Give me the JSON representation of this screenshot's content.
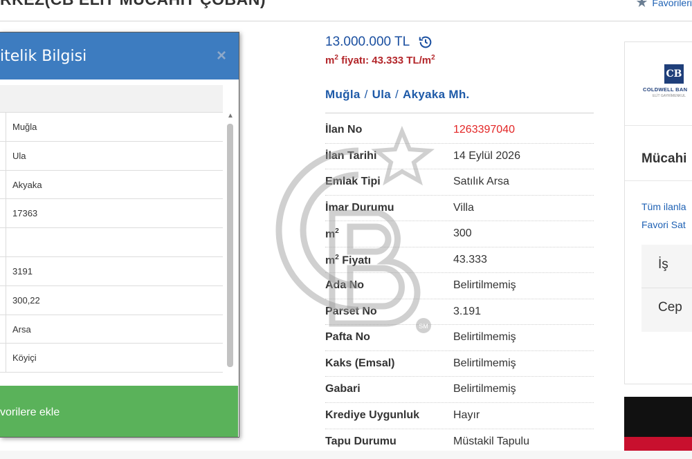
{
  "header": {
    "title": "RKEZ(CB ELİT MÜCAHİT ÇOBAN)",
    "favorites_label": "Favorileri",
    "favorites_icon": "star-icon"
  },
  "modal": {
    "title": "itelik Bilgisi",
    "close_label": "×",
    "rows": [
      "Muğla",
      "Ula",
      "Akyaka",
      "17363",
      "",
      "3191",
      "300,22",
      "Arsa",
      "Köyiçi"
    ],
    "footer_label": "vorilere ekle",
    "footer_color": "#5ab25a",
    "header_color": "#3d7cc0"
  },
  "listing": {
    "price": "13.000.000 TL",
    "m2_price_prefix": "m",
    "m2_price_text": " fiyatı: 43.333 TL/m",
    "breadcrumb": [
      "Muğla",
      "Ula",
      "Akyaka Mh."
    ],
    "breadcrumb_sep": "/",
    "details": [
      {
        "label": "İlan No",
        "value": "1263397040"
      },
      {
        "label": "İlan Tarihi",
        "value": "14 Eylül 2026"
      },
      {
        "label": "Emlak Tipi",
        "value": "Satılık Arsa"
      },
      {
        "label": "İmar Durumu",
        "value": "Villa"
      },
      {
        "label": "m",
        "value": "300"
      },
      {
        "label": "m",
        "label_suffix": " Fiyatı",
        "value": "43.333"
      },
      {
        "label": "Ada No",
        "value": "Belirtilmemiş"
      },
      {
        "label": "Parset No",
        "value": "3.191"
      },
      {
        "label": "Pafta No",
        "value": "Belirtilmemiş"
      },
      {
        "label": "Kaks (Emsal)",
        "value": "Belirtilmemiş"
      },
      {
        "label": "Gabari",
        "value": "Belirtilmemiş"
      },
      {
        "label": "Krediye Uygunluk",
        "value": "Hayır"
      },
      {
        "label": "Tapu Durumu",
        "value": "Müstakil Tapulu"
      }
    ],
    "accent_color": "#1a4fa0",
    "ilan_no_color": "#e32525"
  },
  "watermark": {
    "text": "SM"
  },
  "agent_card": {
    "logo_text": "COLDWELL BAN",
    "logo_mark": "CB",
    "logo_sub": "ELİT GAYRİMENKUL",
    "name": "Mücahi",
    "link_all": "Tüm ilanla",
    "link_fav": "Favori Sat",
    "phone_work": "İş",
    "phone_mobile": "Cep"
  }
}
